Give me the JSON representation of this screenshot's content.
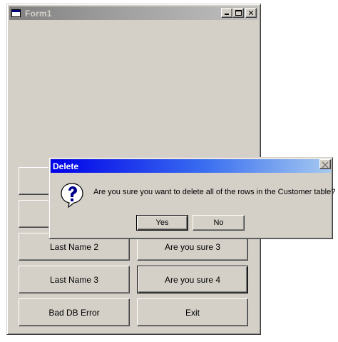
{
  "form": {
    "title": "Form1",
    "caption_buttons": {
      "minimize_icon": "minimize-icon",
      "maximize_icon": "maximize-icon",
      "close_glyph": "✕"
    },
    "buttons": [
      {
        "label": ""
      },
      {
        "label": ""
      },
      {
        "label": ""
      },
      {
        "label": ""
      },
      {
        "label": "Last Name 2"
      },
      {
        "label": "Are you sure 3"
      },
      {
        "label": "Last Name 3"
      },
      {
        "label": "Are you sure 4"
      },
      {
        "label": "Bad DB Error"
      },
      {
        "label": "Exit"
      }
    ]
  },
  "dialog": {
    "title": "Delete",
    "close_glyph": "✕",
    "icon": "question-icon",
    "message": "Are you sure you want to delete all of the rows in the Customer table?",
    "yes_label": "Yes",
    "no_label": "No"
  },
  "colors": {
    "face": "#d4d0c8",
    "inactive_title": "#808080",
    "active_title": "#0000e8",
    "icon_blue": "#00008b"
  }
}
